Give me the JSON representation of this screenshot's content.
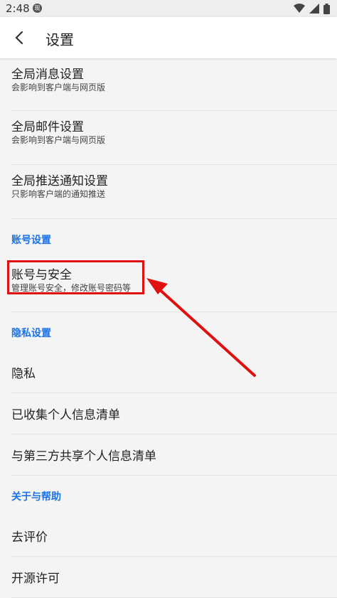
{
  "statusbar": {
    "time": "2:48",
    "badge": "现"
  },
  "toolbar": {
    "title": "设置"
  },
  "items": {
    "global_msg": {
      "title": "全局消息设置",
      "sub": "会影响到客户端与网页版"
    },
    "global_mail": {
      "title": "全局邮件设置",
      "sub": "会影响到客户端与网页版"
    },
    "global_push": {
      "title": "全局推送通知设置",
      "sub": "只影响客户端的通知推送"
    },
    "account_security": {
      "title": "账号与安全",
      "sub": "管理账号安全，修改账号密码等"
    },
    "privacy": {
      "title": "隐私"
    },
    "collected_info": {
      "title": "已收集个人信息清单"
    },
    "third_party": {
      "title": "与第三方共享个人信息清单"
    },
    "rate": {
      "title": "去评价"
    },
    "license": {
      "title": "开源许可"
    }
  },
  "sections": {
    "account": "账号设置",
    "privacy": "隐私设置",
    "about": "关于与帮助"
  },
  "annotation_color": "#e01010",
  "accent": "#1a73e8"
}
